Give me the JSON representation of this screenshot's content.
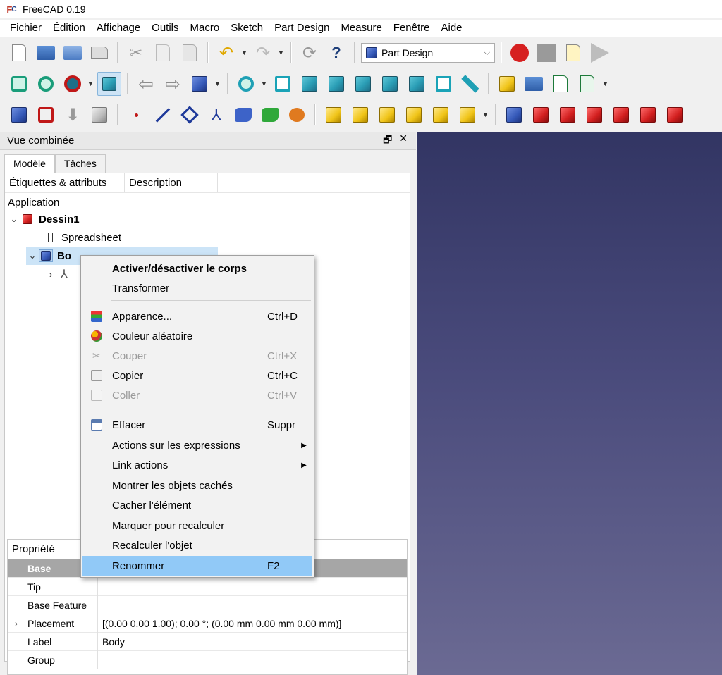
{
  "window": {
    "title": "FreeCAD 0.19"
  },
  "menubar": [
    "Fichier",
    "Édition",
    "Affichage",
    "Outils",
    "Macro",
    "Sketch",
    "Part Design",
    "Measure",
    "Fenêtre",
    "Aide"
  ],
  "toolbar": {
    "workbench": "Part Design"
  },
  "panel": {
    "title": "Vue combinée",
    "float_glyph": "🗗",
    "close_glyph": "✕",
    "tabs": [
      "Modèle",
      "Tâches"
    ],
    "columns": [
      "Étiquettes & attributs",
      "Description"
    ],
    "tree": {
      "root": "Application",
      "document": "Dessin1",
      "spreadsheet": "Spreadsheet",
      "body": "Bo"
    }
  },
  "properties": {
    "title": "Propriété",
    "group": "Base",
    "rows": [
      {
        "name": "Tip",
        "value": ""
      },
      {
        "name": "Base Feature",
        "value": ""
      },
      {
        "name": "Placement",
        "value": "[(0.00 0.00 1.00); 0.00 °; (0.00 mm  0.00 mm  0.00 mm)]",
        "expandable": true
      },
      {
        "name": "Label",
        "value": "Body"
      },
      {
        "name": "Group",
        "value": ""
      }
    ]
  },
  "context_menu": {
    "items": [
      {
        "label": "Activer/désactiver le corps",
        "shortcut": "",
        "bold": true
      },
      {
        "label": "Transformer",
        "shortcut": ""
      },
      {
        "label": "Apparence...",
        "shortcut": "Ctrl+D"
      },
      {
        "label": "Couleur aléatoire",
        "shortcut": ""
      },
      {
        "label": "Couper",
        "shortcut": "Ctrl+X",
        "disabled": true
      },
      {
        "label": "Copier",
        "shortcut": "Ctrl+C"
      },
      {
        "label": "Coller",
        "shortcut": "Ctrl+V",
        "disabled": true
      },
      {
        "label": "Effacer",
        "shortcut": "Suppr"
      },
      {
        "label": "Actions sur les expressions",
        "submenu": true
      },
      {
        "label": "Link actions",
        "submenu": true
      },
      {
        "label": "Montrer les objets cachés",
        "shortcut": ""
      },
      {
        "label": "Cacher l'élément",
        "shortcut": ""
      },
      {
        "label": "Marquer pour recalculer",
        "shortcut": ""
      },
      {
        "label": "Recalculer l'objet",
        "shortcut": ""
      },
      {
        "label": "Renommer",
        "shortcut": "F2",
        "highlighted": true
      }
    ]
  },
  "colors": {
    "accent": "#91c9f7",
    "selection": "#cce4f7",
    "view_top": "#323563",
    "view_bottom": "#6b6a93"
  }
}
